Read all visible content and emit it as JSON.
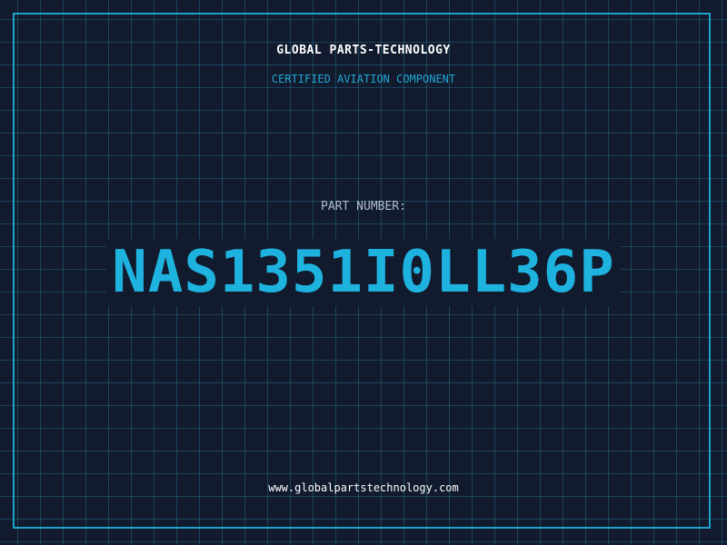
{
  "header": {
    "company": "GLOBAL PARTS-TECHNOLOGY",
    "subtitle": "CERTIFIED AVIATION COMPONENT"
  },
  "part": {
    "label": "PART NUMBER:",
    "number": "NAS1351I0LL36P"
  },
  "footer": {
    "website": "www.globalpartstechnology.com"
  },
  "colors": {
    "background": "#121a2e",
    "grid": "#24788f",
    "accent": "#1eb3df",
    "text": "#ffffff"
  }
}
